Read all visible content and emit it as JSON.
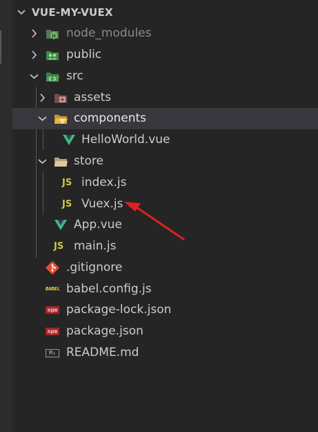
{
  "explorer": {
    "title": "VUE-MY-VUEX",
    "items": [
      {
        "label": "node_modules",
        "kind": "folder",
        "icon": "node-folder-icon",
        "state": "collapsed"
      },
      {
        "label": "public",
        "kind": "folder",
        "icon": "public-folder-icon",
        "state": "collapsed"
      },
      {
        "label": "src",
        "kind": "folder",
        "icon": "src-folder-icon",
        "state": "expanded"
      },
      {
        "label": "assets",
        "kind": "folder",
        "icon": "assets-folder-icon",
        "state": "collapsed"
      },
      {
        "label": "components",
        "kind": "folder",
        "icon": "components-folder-icon",
        "state": "expanded"
      },
      {
        "label": "HelloWorld.vue",
        "kind": "file",
        "icon": "vue-file-icon"
      },
      {
        "label": "store",
        "kind": "folder",
        "icon": "folder-open-icon",
        "state": "expanded"
      },
      {
        "label": "index.js",
        "kind": "file",
        "icon": "js-file-icon"
      },
      {
        "label": "Vuex.js",
        "kind": "file",
        "icon": "js-file-icon"
      },
      {
        "label": "App.vue",
        "kind": "file",
        "icon": "vue-file-icon"
      },
      {
        "label": "main.js",
        "kind": "file",
        "icon": "js-file-icon"
      },
      {
        "label": ".gitignore",
        "kind": "file",
        "icon": "git-file-icon"
      },
      {
        "label": "babel.config.js",
        "kind": "file",
        "icon": "babel-file-icon"
      },
      {
        "label": "package-lock.json",
        "kind": "file",
        "icon": "npm-file-icon"
      },
      {
        "label": "package.json",
        "kind": "file",
        "icon": "npm-file-icon"
      },
      {
        "label": "README.md",
        "kind": "file",
        "icon": "markdown-file-icon"
      }
    ]
  },
  "icons": {
    "js_text": "JS",
    "babel_text": "BABEL",
    "npm_text": "npm",
    "md_text": "M↓"
  },
  "colors": {
    "background": "#252526",
    "selected_row": "#37373d",
    "text": "#cccccc",
    "dimmed_text": "#8b8b8b",
    "vue_green": "#41b883",
    "js_yellow": "#cbcb41",
    "annotation_arrow": "#e0201c"
  }
}
